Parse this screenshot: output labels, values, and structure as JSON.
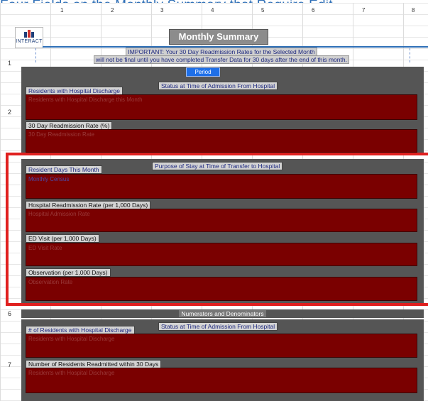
{
  "banner": "Four Fields on the Monthly Summary that Require Edit...",
  "columns": [
    "1",
    "2",
    "3",
    "4",
    "5",
    "6",
    "7",
    "8"
  ],
  "rows": [
    "1",
    "2",
    "6",
    "7"
  ],
  "logo": {
    "text": "INTERACT"
  },
  "title": "Monthly Summary",
  "important": {
    "line1": "IMPORTANT:  Your 30 Day Readmission Rates for the Selected Month",
    "line2": "will not be final until you have completed Transfer Data for 30 days after the end of this month."
  },
  "period": "Period",
  "section1": {
    "caption": "Status at Time of Admission From Hospital",
    "items": [
      {
        "label": "Residents with Hospital Discharge",
        "value": "Residents with Hospital Discharge this Month"
      },
      {
        "label": "30 Day Readmission Rate (%)",
        "value": "30 Day Readmission Rate"
      }
    ]
  },
  "section2": {
    "caption": "Purpose of Stay at Time of Transfer to Hospital",
    "items": [
      {
        "label": "Resident Days This Month",
        "value": "Monthly Census"
      },
      {
        "label": "Hospital Readmission Rate (per 1,000 Days)",
        "value": "Hospital Admission Rate"
      },
      {
        "label": "ED Visit (per 1,000 Days)",
        "value": "ED Visit Rate"
      },
      {
        "label": "Observation (per 1,000 Days)",
        "value": "Observation Rate"
      }
    ]
  },
  "section3": {
    "header": "Numerators and Denominators",
    "caption": "Status at Time of Admission From Hospital",
    "items": [
      {
        "label": "# of Residents with Hospital Discharge",
        "value": "Residents with Hospital Discharge"
      },
      {
        "label": "Number of Residents Readmitted within 30 Days",
        "value": "Residents with Hospital Discharge"
      }
    ]
  },
  "colors": {
    "field": "#7a0000",
    "panel": "#555555",
    "accent": "#2E6FB7",
    "highlight": "#e0201f",
    "period": "#1E6FE8"
  }
}
